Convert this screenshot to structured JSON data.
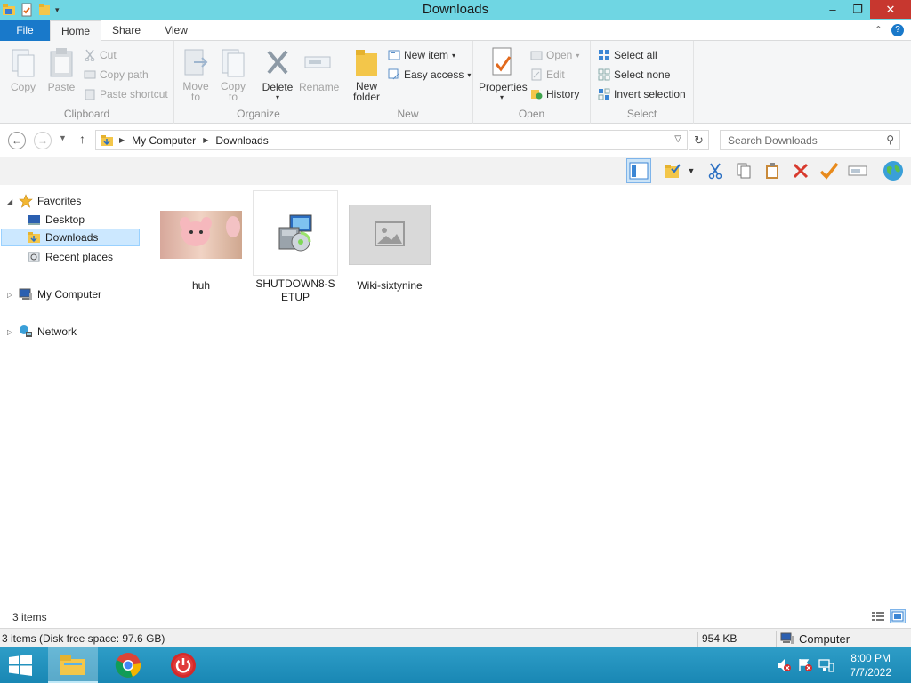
{
  "window": {
    "title": "Downloads"
  },
  "ribbon_tabs": {
    "file": "File",
    "home": "Home",
    "share": "Share",
    "view": "View"
  },
  "ribbon": {
    "clipboard": {
      "label": "Clipboard",
      "copy": "Copy",
      "paste": "Paste",
      "cut": "Cut",
      "copy_path": "Copy path",
      "paste_shortcut": "Paste shortcut"
    },
    "organize": {
      "label": "Organize",
      "move_to": "Move",
      "move_to_2": "to",
      "copy_to": "Copy",
      "copy_to_2": "to",
      "delete": "Delete",
      "rename": "Rename"
    },
    "new": {
      "label": "New",
      "new_folder": "New",
      "new_folder_2": "folder",
      "new_item": "New item",
      "easy_access": "Easy access"
    },
    "open": {
      "label": "Open",
      "properties": "Properties",
      "open": "Open",
      "edit": "Edit",
      "history": "History"
    },
    "select": {
      "label": "Select",
      "select_all": "Select all",
      "select_none": "Select none",
      "invert_selection": "Invert selection"
    }
  },
  "address": {
    "crumbs": [
      "My Computer",
      "Downloads"
    ],
    "search_placeholder": "Search Downloads"
  },
  "nav": {
    "favorites": "Favorites",
    "desktop": "Desktop",
    "downloads": "Downloads",
    "recent_places": "Recent places",
    "my_computer": "My Computer",
    "network": "Network"
  },
  "files": [
    {
      "name": "huh",
      "icon": "image-thumbnail"
    },
    {
      "name": "SHUTDOWN8-SETUP",
      "icon": "installer-icon"
    },
    {
      "name": "Wiki-sixtynine",
      "icon": "image-thumbnail-placeholder"
    }
  ],
  "status": {
    "item_count": "3 items",
    "disk_info": "3 items (Disk free space: 97.6 GB)",
    "size": "954 KB",
    "location": "Computer"
  },
  "taskbar": {
    "time": "8:00 PM",
    "date": "7/7/2022"
  },
  "colors": {
    "titlebar": "#6fd6e3",
    "file_tab": "#1979ca",
    "taskbar": "#2394c0",
    "selection": "#cce8ff"
  }
}
